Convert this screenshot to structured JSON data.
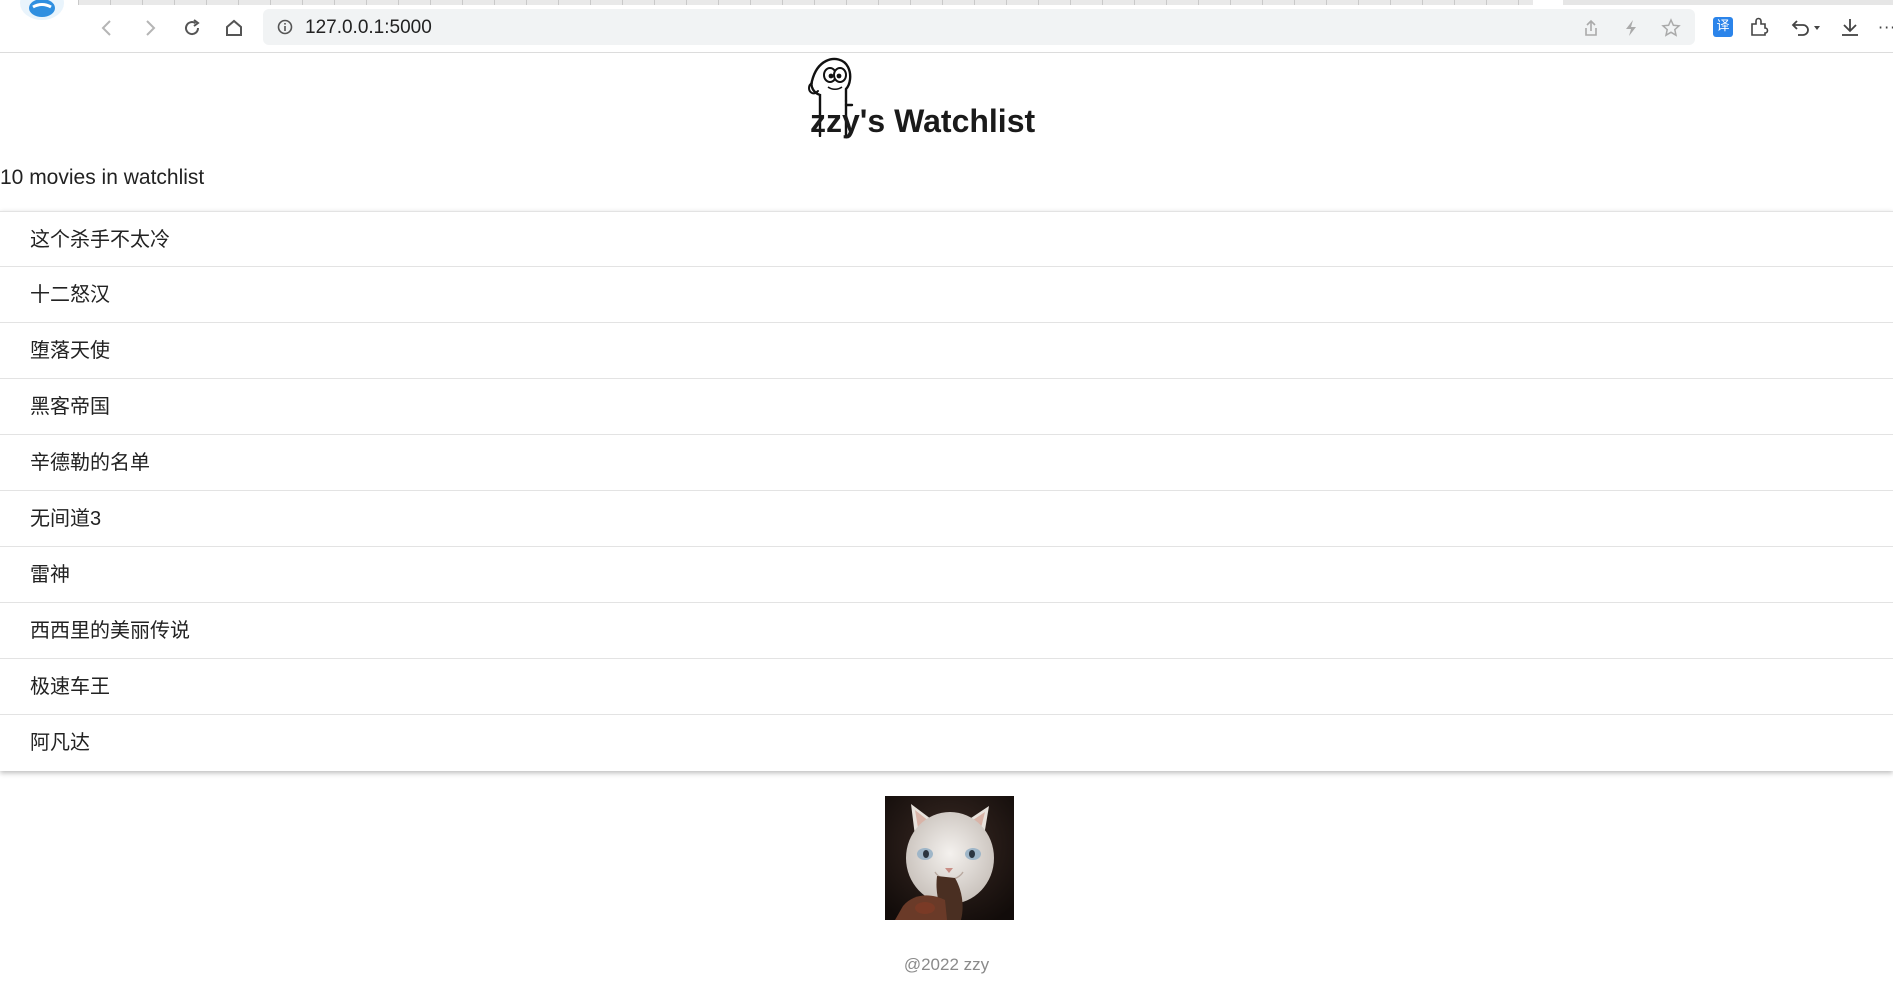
{
  "browser": {
    "address": "127.0.0.1:5000",
    "icons": [
      "browser-logo-icon",
      "back-icon",
      "forward-icon",
      "reload-icon",
      "home-icon",
      "info-icon",
      "share-icon",
      "flash-icon",
      "star-icon",
      "translate-icon",
      "extensions-icon",
      "undo-icon",
      "download-icon",
      "more-icon"
    ],
    "translate_glyph": "译",
    "more_glyph": "···"
  },
  "header": {
    "title": "zzy's Watchlist"
  },
  "summary": "10 movies in watchlist",
  "movies": [
    "这个杀手不太冷",
    "十二怒汉",
    "堕落天使",
    "黑客帝国",
    "辛德勒的名单",
    "无间道3",
    "雷神",
    "西西里的美丽传说",
    "极速车王",
    "阿凡达"
  ],
  "footer": "@2022 zzy"
}
